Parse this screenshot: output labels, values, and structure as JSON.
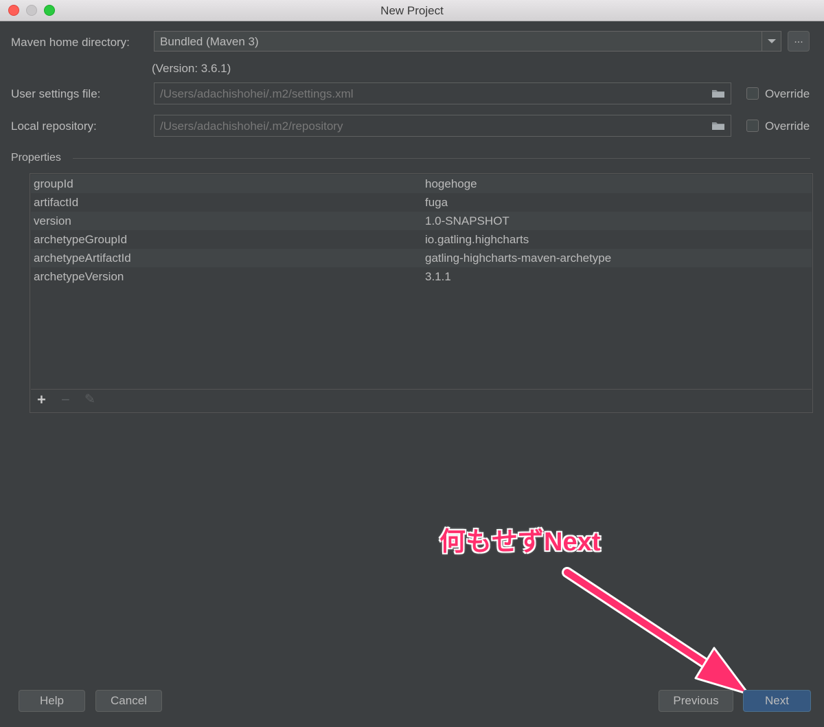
{
  "window": {
    "title": "New Project"
  },
  "maven": {
    "home_label": "Maven home directory:",
    "home_value": "Bundled (Maven 3)",
    "dots_label": "...",
    "version_text": "(Version: 3.6.1)",
    "user_settings_label": "User settings file:",
    "user_settings_value": "/Users/adachishohei/.m2/settings.xml",
    "local_repo_label": "Local repository:",
    "local_repo_value": "/Users/adachishohei/.m2/repository",
    "override_label": "Override"
  },
  "properties": {
    "section_label": "Properties",
    "rows": [
      {
        "key": "groupId",
        "value": "hogehoge"
      },
      {
        "key": "artifactId",
        "value": "fuga"
      },
      {
        "key": "version",
        "value": "1.0-SNAPSHOT"
      },
      {
        "key": "archetypeGroupId",
        "value": "io.gatling.highcharts"
      },
      {
        "key": "archetypeArtifactId",
        "value": "gatling-highcharts-maven-archetype"
      },
      {
        "key": "archetypeVersion",
        "value": "3.1.1"
      }
    ],
    "toolbar": {
      "add": "+",
      "remove": "−",
      "edit": "✎"
    }
  },
  "buttons": {
    "help": "Help",
    "cancel": "Cancel",
    "previous": "Previous",
    "next": "Next"
  },
  "annotation": {
    "text": "何もせずNext",
    "color": "#ff2f6d"
  },
  "colors": {
    "background": "#3c3f41",
    "primary_button": "#365880"
  }
}
